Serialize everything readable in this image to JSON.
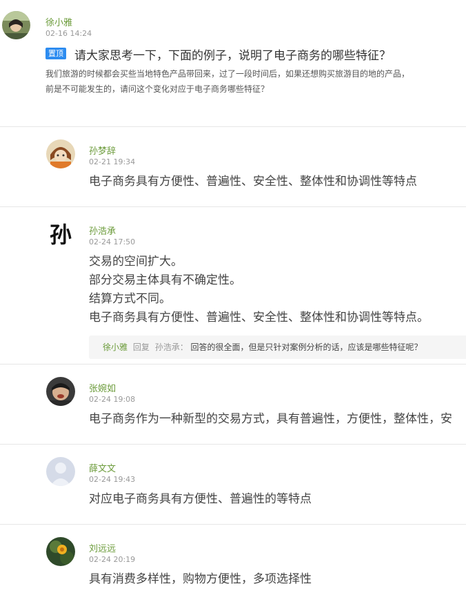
{
  "post": {
    "author": "徐小雅",
    "time": "02-16 14:24",
    "pin_label": "置顶",
    "title": "请大家思考一下，下面的例子，说明了电子商务的哪些特征？",
    "body_lines": [
      "我们旅游的时候都会买些当地特色产品带回来，过了一段时间后，如果还想购买旅游目的地的产品，",
      "前是不可能发生的，请问这个变化对应于电子商务哪些特征？"
    ]
  },
  "replies": [
    {
      "author": "孙梦辞",
      "time": "02-21 19:34",
      "lines": [
        "电子商务具有方便性、普遍性、安全性、整体性和协调性等特点"
      ]
    },
    {
      "author": "孙浩承",
      "time": "02-24 17:50",
      "lines": [
        "交易的空间扩大。",
        "部分交易主体具有不确定性。",
        "结算方式不同。",
        "电子商务具有方便性、普遍性、安全性、整体性和协调性等特点。"
      ],
      "avatar_char": "孙",
      "sub_reply": {
        "author": "徐小雅",
        "verb": "回复",
        "target": "孙浩承：",
        "text": "回答的很全面，但是只针对案例分析的话，应该是哪些特征呢？"
      }
    },
    {
      "author": "张婉如",
      "time": "02-24 19:08",
      "lines": [
        "电子商务作为一种新型的交易方式，具有普遍性，方便性，整体性，安"
      ]
    },
    {
      "author": "薛文文",
      "time": "02-24 19:43",
      "lines": [
        "对应电子商务具有方便性、普遍性的等特点"
      ]
    },
    {
      "author": "刘远远",
      "time": "02-24 20:19",
      "lines": [
        "具有消费多样性，购物方便性，多项选择性"
      ]
    }
  ]
}
